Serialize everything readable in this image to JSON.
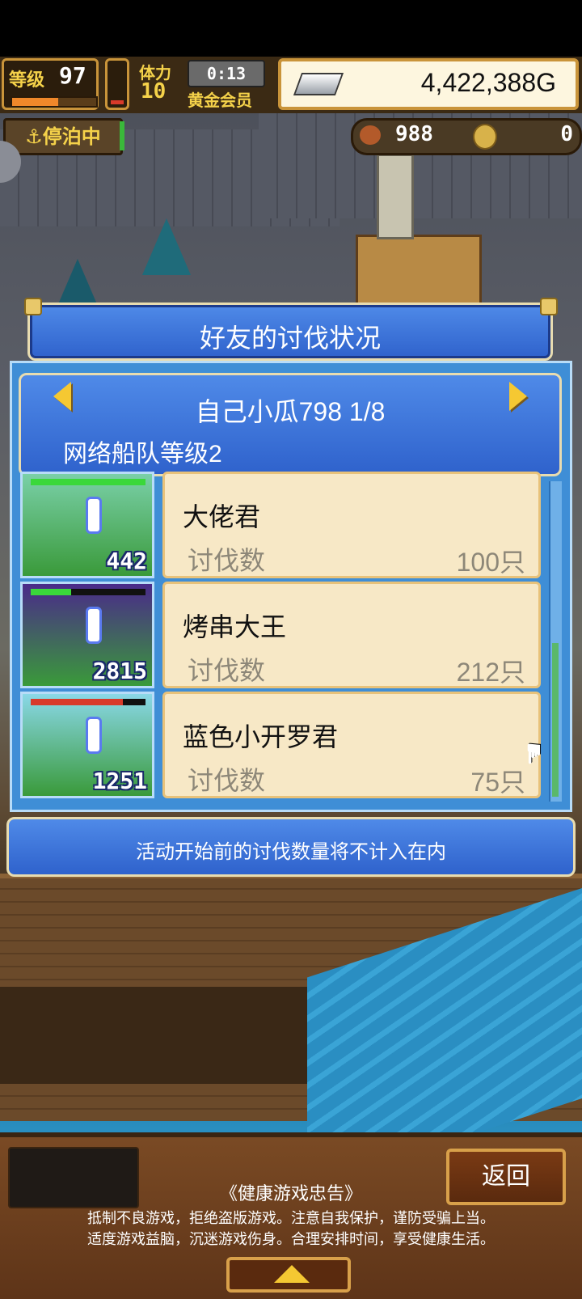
{
  "hud": {
    "level_label": "等级",
    "level": "97",
    "hp_label": "体力",
    "hp_value": "10",
    "timer": "0:13",
    "vip_label": "黄金会员",
    "gold": "4,422,388G",
    "moored": "停泊中",
    "resource1": "988",
    "resource2": "0",
    "level_exp_fraction": 0.55,
    "stamina_fraction": 0.1
  },
  "dialog": {
    "title": "好友的讨伐状况",
    "friend_name": "自己小瓜798 1/8",
    "fleet_level": "网络船队等级2",
    "note": "活动开始前的讨伐数量将不计入在内"
  },
  "entries": [
    {
      "name": "大佬君",
      "label": "讨伐数",
      "value": "100只",
      "thumb_number": "442",
      "hp_fraction": 1.0,
      "hp_color": "#3ad83a",
      "bg": "#7ad0a8"
    },
    {
      "name": "烤串大王",
      "label": "讨伐数",
      "value": "212只",
      "thumb_number": "2815",
      "hp_fraction": 0.35,
      "hp_color": "#3ad83a",
      "bg": "#4a2a8a"
    },
    {
      "name": "蓝色小开罗君",
      "label": "讨伐数",
      "value": "75只",
      "thumb_number": "1251",
      "hp_fraction": 0.8,
      "hp_color": "#d83a2a",
      "bg": "#8ad8e8"
    }
  ],
  "footer": {
    "back_label": "返回",
    "notice_title": "《健康游戏忠告》",
    "notice_line1": "抵制不良游戏，拒绝盗版游戏。注意自我保护，谨防受骗上当。",
    "notice_line2": "适度游戏益脑，沉迷游戏伤身。合理安排时间，享受健康生活。"
  },
  "icons": {
    "anchor": "anchor-icon",
    "silver": "silver-ingot-icon",
    "meat": "meat-icon",
    "coin": "coin-icon",
    "cursor": "hand-pointer-icon"
  }
}
